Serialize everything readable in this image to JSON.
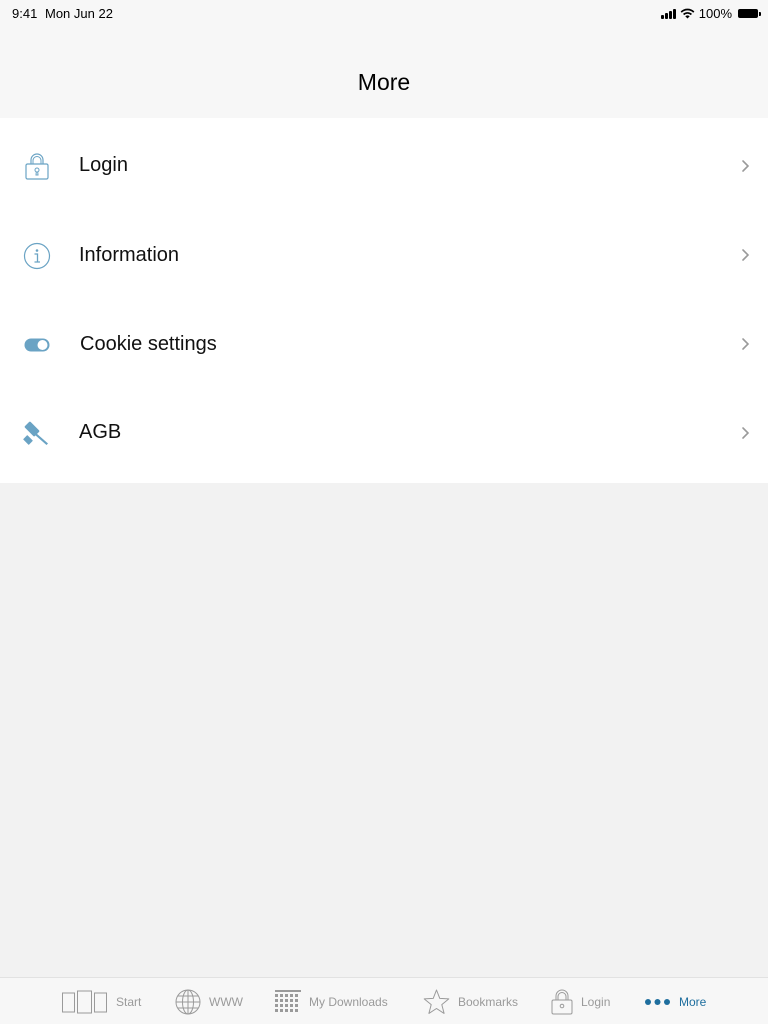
{
  "status_bar": {
    "time": "9:41",
    "date": "Mon Jun 22",
    "battery": "100%"
  },
  "header": {
    "title": "More"
  },
  "menu": {
    "items": [
      {
        "label": "Login",
        "icon": "lock-icon"
      },
      {
        "label": "Information",
        "icon": "info-icon"
      },
      {
        "label": "Cookie settings",
        "icon": "toggle-icon"
      },
      {
        "label": "AGB",
        "icon": "gavel-icon"
      }
    ]
  },
  "tab_bar": {
    "tabs": [
      {
        "label": "Start",
        "icon": "pages-icon"
      },
      {
        "label": "WWW",
        "icon": "globe-icon"
      },
      {
        "label": "My Downloads",
        "icon": "grid-icon"
      },
      {
        "label": "Bookmarks",
        "icon": "star-icon"
      },
      {
        "label": "Login",
        "icon": "lock-icon"
      },
      {
        "label": "More",
        "icon": "more-dots-icon",
        "active": true
      }
    ]
  },
  "colors": {
    "accent": "#1e6e9e",
    "icon": "#6aa3c4",
    "inactive": "#9a9a9a",
    "chevron": "#9a9a9a"
  }
}
